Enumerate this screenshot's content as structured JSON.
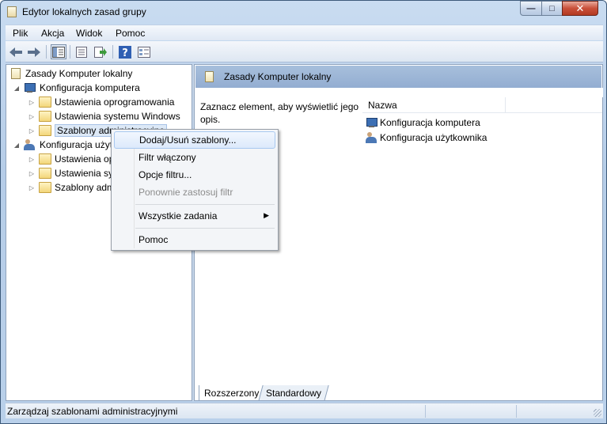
{
  "window": {
    "title": "Edytor lokalnych zasad grupy"
  },
  "menubar": {
    "items": [
      "Plik",
      "Akcja",
      "Widok",
      "Pomoc"
    ]
  },
  "toolbar": {
    "buttons": [
      "back-arrow-icon",
      "forward-arrow-icon",
      "show-tree-icon",
      "properties-icon",
      "export-icon",
      "help-icon",
      "view-icon"
    ]
  },
  "tree": {
    "root": "Zasady Komputer lokalny",
    "computer": "Konfiguracja komputera",
    "computer_children": [
      "Ustawienia oprogramowania",
      "Ustawienia systemu Windows",
      "Szablony administracyjne"
    ],
    "user": "Konfiguracja użytkownika",
    "user_children": [
      "Ustawienia oprogramowania",
      "Ustawienia systemu Windows",
      "Szablony administracyjne"
    ]
  },
  "right_pane": {
    "header": "Zasady Komputer lokalny",
    "description": "Zaznacz element, aby wyświetlić jego opis.",
    "column_name": "Nazwa",
    "items": [
      "Konfiguracja komputera",
      "Konfiguracja użytkownika"
    ]
  },
  "tabs": {
    "extended": "Rozszerzony",
    "standard": "Standardowy"
  },
  "status": {
    "text": "Zarządzaj szablonami administracyjnymi"
  },
  "context_menu": {
    "items": [
      "Dodaj/Usuń szablony...",
      "Filtr włączony",
      "Opcje filtru...",
      "Ponownie zastosuj filtr",
      "Wszystkie zadania",
      "Pomoc"
    ]
  }
}
